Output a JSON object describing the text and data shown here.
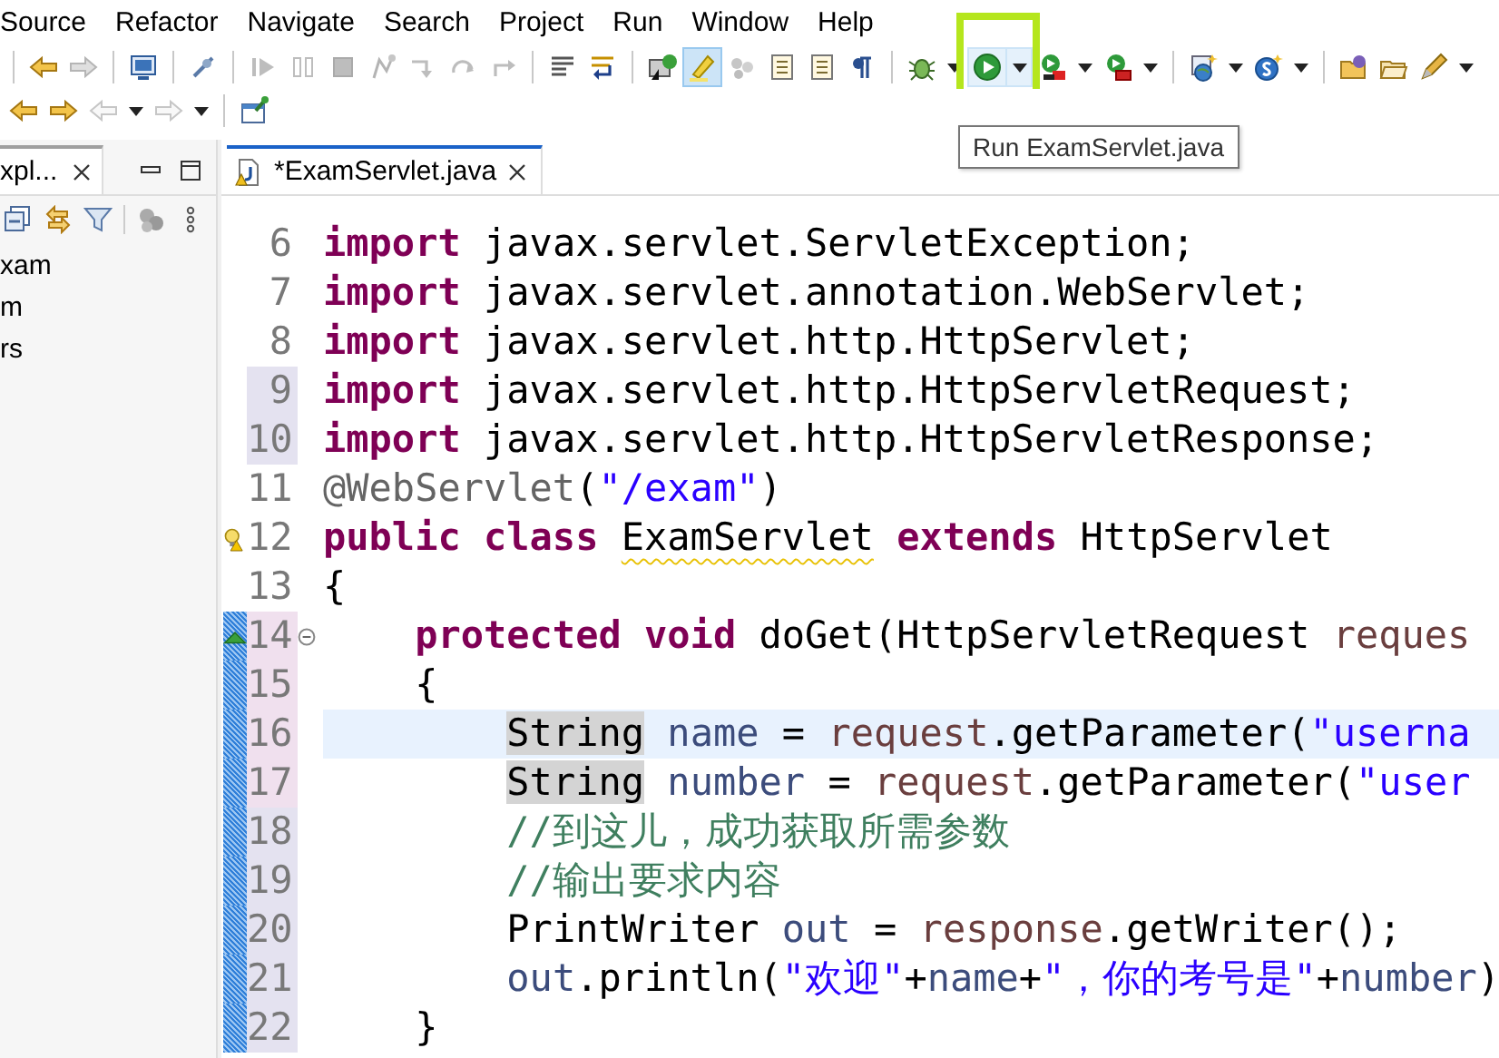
{
  "menu": [
    {
      "label": "Source"
    },
    {
      "label": "Refactor"
    },
    {
      "label": "Navigate"
    },
    {
      "label": "Search"
    },
    {
      "label": "Project"
    },
    {
      "label": "Run"
    },
    {
      "label": "Window"
    },
    {
      "label": "Help"
    }
  ],
  "toolbars": [
    {
      "items": [
        {
          "kind": "separator"
        },
        {
          "kind": "back-edit",
          "disabled": false,
          "dropdown": false,
          "on": false,
          "hovered": false,
          "highlighted": false
        },
        {
          "kind": "forward-edit",
          "disabled": true,
          "dropdown": false,
          "on": false,
          "hovered": false,
          "highlighted": false
        },
        {
          "kind": "separator"
        },
        {
          "kind": "monitor",
          "disabled": false,
          "dropdown": false,
          "on": false,
          "hovered": false,
          "highlighted": false
        },
        {
          "kind": "separator"
        },
        {
          "kind": "pin",
          "disabled": false,
          "dropdown": false,
          "on": false,
          "hovered": false,
          "highlighted": false
        },
        {
          "kind": "separator"
        },
        {
          "kind": "resume",
          "disabled": true,
          "dropdown": false,
          "on": false,
          "hovered": false,
          "highlighted": false
        },
        {
          "kind": "pause",
          "disabled": true,
          "dropdown": false,
          "on": false,
          "hovered": false,
          "highlighted": false
        },
        {
          "kind": "stop",
          "disabled": true,
          "dropdown": false,
          "on": false,
          "hovered": false,
          "highlighted": false
        },
        {
          "kind": "disconnect",
          "disabled": true,
          "dropdown": false,
          "on": false,
          "hovered": false,
          "highlighted": false
        },
        {
          "kind": "step-into",
          "disabled": true,
          "dropdown": false,
          "on": false,
          "hovered": false,
          "highlighted": false
        },
        {
          "kind": "step-over",
          "disabled": true,
          "dropdown": false,
          "on": false,
          "hovered": false,
          "highlighted": false
        },
        {
          "kind": "step-return",
          "disabled": true,
          "dropdown": false,
          "on": false,
          "hovered": false,
          "highlighted": false
        },
        {
          "kind": "separator"
        },
        {
          "kind": "list",
          "disabled": false,
          "dropdown": false,
          "on": false,
          "hovered": false,
          "highlighted": false
        },
        {
          "kind": "wrap",
          "disabled": false,
          "dropdown": false,
          "on": false,
          "hovered": false,
          "highlighted": false
        },
        {
          "kind": "separator"
        },
        {
          "kind": "display",
          "disabled": false,
          "dropdown": false,
          "on": false,
          "hovered": false,
          "highlighted": false
        },
        {
          "kind": "highlighter",
          "disabled": false,
          "dropdown": false,
          "on": true,
          "hovered": false,
          "highlighted": false
        },
        {
          "kind": "dots",
          "disabled": true,
          "dropdown": false,
          "on": false,
          "hovered": false,
          "highlighted": false
        },
        {
          "kind": "document",
          "disabled": false,
          "dropdown": false,
          "on": false,
          "hovered": false,
          "highlighted": false
        },
        {
          "kind": "document",
          "disabled": false,
          "dropdown": false,
          "on": false,
          "hovered": false,
          "highlighted": false
        },
        {
          "kind": "pilcrow",
          "disabled": false,
          "dropdown": false,
          "on": false,
          "hovered": false,
          "highlighted": false
        },
        {
          "kind": "separator"
        },
        {
          "kind": "bug",
          "disabled": false,
          "dropdown": true,
          "on": false,
          "hovered": false,
          "highlighted": false
        },
        {
          "kind": "run",
          "disabled": false,
          "dropdown": true,
          "on": false,
          "hovered": true,
          "highlighted": true
        },
        {
          "kind": "coverage",
          "disabled": false,
          "dropdown": true,
          "on": false,
          "hovered": false,
          "highlighted": false
        },
        {
          "kind": "external",
          "disabled": false,
          "dropdown": true,
          "on": false,
          "hovered": false,
          "highlighted": false
        },
        {
          "kind": "separator"
        },
        {
          "kind": "globe",
          "disabled": false,
          "dropdown": true,
          "on": false,
          "hovered": false,
          "highlighted": false
        },
        {
          "kind": "s-circle",
          "disabled": false,
          "dropdown": true,
          "on": false,
          "hovered": false,
          "highlighted": false
        },
        {
          "kind": "separator"
        },
        {
          "kind": "folder-purple",
          "disabled": false,
          "dropdown": false,
          "on": false,
          "hovered": false,
          "highlighted": false
        },
        {
          "kind": "folder",
          "disabled": false,
          "dropdown": false,
          "on": false,
          "hovered": false,
          "highlighted": false
        },
        {
          "kind": "pen",
          "disabled": false,
          "dropdown": true,
          "on": false,
          "hovered": false,
          "highlighted": false
        }
      ]
    },
    {
      "items": [
        {
          "kind": "back-edit",
          "disabled": false,
          "dropdown": false,
          "on": false,
          "hovered": false,
          "highlighted": false
        },
        {
          "kind": "forward-edit",
          "disabled": false,
          "dropdown": false,
          "on": false,
          "hovered": false,
          "highlighted": false
        },
        {
          "kind": "back-nav",
          "disabled": true,
          "dropdown": true,
          "on": false,
          "hovered": false,
          "highlighted": false
        },
        {
          "kind": "forward-nav",
          "disabled": true,
          "dropdown": true,
          "on": false,
          "hovered": false,
          "highlighted": false
        },
        {
          "kind": "separator"
        },
        {
          "kind": "window-pin",
          "disabled": false,
          "dropdown": false,
          "on": false,
          "hovered": false,
          "highlighted": false
        }
      ]
    }
  ],
  "tooltip": {
    "text": "Run ExamServlet.java"
  },
  "explorer": {
    "tab_label": "xpl...",
    "tree": [
      {
        "label": "xam"
      },
      {
        "label": "m"
      },
      {
        "label": "rs"
      }
    ]
  },
  "editor": {
    "tabs": [
      {
        "label": "*ExamServlet.java",
        "selected": true
      }
    ],
    "lines": [
      {
        "number": "6",
        "kind": "unchanged",
        "range": false,
        "current": false,
        "tokens": [
          {
            "kind": "keyword",
            "text": "import"
          },
          {
            "kind": "plain",
            "text": " javax.servlet.ServletException;"
          }
        ]
      },
      {
        "number": "7",
        "kind": "unchanged",
        "range": false,
        "current": false,
        "tokens": [
          {
            "kind": "keyword",
            "text": "import"
          },
          {
            "kind": "plain",
            "text": " javax.servlet.annotation.WebServlet;"
          }
        ]
      },
      {
        "number": "8",
        "kind": "unchanged",
        "range": false,
        "current": false,
        "tokens": [
          {
            "kind": "keyword",
            "text": "import"
          },
          {
            "kind": "plain",
            "text": " javax.servlet.http.HttpServlet;"
          }
        ]
      },
      {
        "number": "9",
        "kind": "changed",
        "range": false,
        "current": false,
        "tokens": [
          {
            "kind": "keyword",
            "text": "import"
          },
          {
            "kind": "plain",
            "text": " javax.servlet.http.HttpServletRequest;"
          }
        ]
      },
      {
        "number": "10",
        "kind": "changed",
        "range": false,
        "current": false,
        "tokens": [
          {
            "kind": "keyword",
            "text": "import"
          },
          {
            "kind": "plain",
            "text": " javax.servlet.http.HttpServletResponse;"
          }
        ]
      },
      {
        "number": "11",
        "kind": "unchanged",
        "range": false,
        "current": false,
        "tokens": [
          {
            "kind": "annotation",
            "text": "@WebServlet"
          },
          {
            "kind": "plain",
            "text": "("
          },
          {
            "kind": "string",
            "text": "\"/exam\""
          },
          {
            "kind": "plain",
            "text": ")"
          }
        ]
      },
      {
        "number": "12",
        "kind": "unchanged",
        "range": false,
        "current": false,
        "marker": {
          "kind": "warning"
        },
        "tokens": [
          {
            "kind": "keyword",
            "text": "public class "
          },
          {
            "kind": "warning",
            "text": "ExamServlet"
          },
          {
            "kind": "keyword",
            "text": " extends"
          },
          {
            "kind": "plain",
            "text": " HttpServlet"
          }
        ]
      },
      {
        "number": "13",
        "kind": "unchanged",
        "range": false,
        "current": false,
        "tokens": [
          {
            "kind": "plain",
            "text": "{"
          }
        ]
      },
      {
        "number": "14",
        "kind": "added",
        "range": true,
        "current": false,
        "marker": {
          "kind": "override"
        },
        "fold": {
          "expanded": true
        },
        "tokens": [
          {
            "kind": "keyword",
            "text": "    protected void"
          },
          {
            "kind": "plain",
            "text": " doGet(HttpServletRequest "
          },
          {
            "kind": "parameter",
            "text": "reques"
          }
        ]
      },
      {
        "number": "15",
        "kind": "added",
        "range": true,
        "current": false,
        "tokens": [
          {
            "kind": "plain",
            "text": "    {"
          }
        ]
      },
      {
        "number": "16",
        "kind": "added",
        "range": true,
        "current": true,
        "tokens": [
          {
            "kind": "occurrence",
            "text": "        String"
          },
          {
            "kind": "variable",
            "text": " name"
          },
          {
            "kind": "plain",
            "text": " = "
          },
          {
            "kind": "parameter",
            "text": "request"
          },
          {
            "kind": "plain",
            "text": ".getParameter("
          },
          {
            "kind": "string",
            "text": "\"userna"
          }
        ]
      },
      {
        "number": "17",
        "kind": "added",
        "range": true,
        "current": false,
        "tokens": [
          {
            "kind": "occurrence",
            "text": "        String"
          },
          {
            "kind": "variable",
            "text": " number"
          },
          {
            "kind": "plain",
            "text": " = "
          },
          {
            "kind": "parameter",
            "text": "request"
          },
          {
            "kind": "plain",
            "text": ".getParameter("
          },
          {
            "kind": "string",
            "text": "\"user"
          }
        ]
      },
      {
        "number": "18",
        "kind": "changed",
        "range": true,
        "current": false,
        "tokens": [
          {
            "kind": "comment",
            "text": "        //到这儿，成功获取所需参数"
          }
        ]
      },
      {
        "number": "19",
        "kind": "changed",
        "range": true,
        "current": false,
        "tokens": [
          {
            "kind": "comment",
            "text": "        //输出要求内容"
          }
        ]
      },
      {
        "number": "20",
        "kind": "changed",
        "range": true,
        "current": false,
        "tokens": [
          {
            "kind": "plain",
            "text": "        PrintWriter "
          },
          {
            "kind": "variable",
            "text": "out"
          },
          {
            "kind": "plain",
            "text": " = "
          },
          {
            "kind": "parameter",
            "text": "response"
          },
          {
            "kind": "plain",
            "text": ".getWriter();"
          }
        ]
      },
      {
        "number": "21",
        "kind": "changed",
        "range": true,
        "current": false,
        "tokens": [
          {
            "kind": "variable",
            "text": "        out"
          },
          {
            "kind": "plain",
            "text": ".println("
          },
          {
            "kind": "string",
            "text": "\"欢迎\""
          },
          {
            "kind": "plain",
            "text": "+"
          },
          {
            "kind": "variable",
            "text": "name"
          },
          {
            "kind": "plain",
            "text": "+"
          },
          {
            "kind": "string",
            "text": "\"，你的考号是\""
          },
          {
            "kind": "plain",
            "text": "+"
          },
          {
            "kind": "variable",
            "text": "number"
          },
          {
            "kind": "plain",
            "text": ")"
          }
        ]
      },
      {
        "number": "22",
        "kind": "changed",
        "range": true,
        "current": false,
        "tokens": [
          {
            "kind": "plain",
            "text": "    }"
          }
        ]
      }
    ]
  }
}
